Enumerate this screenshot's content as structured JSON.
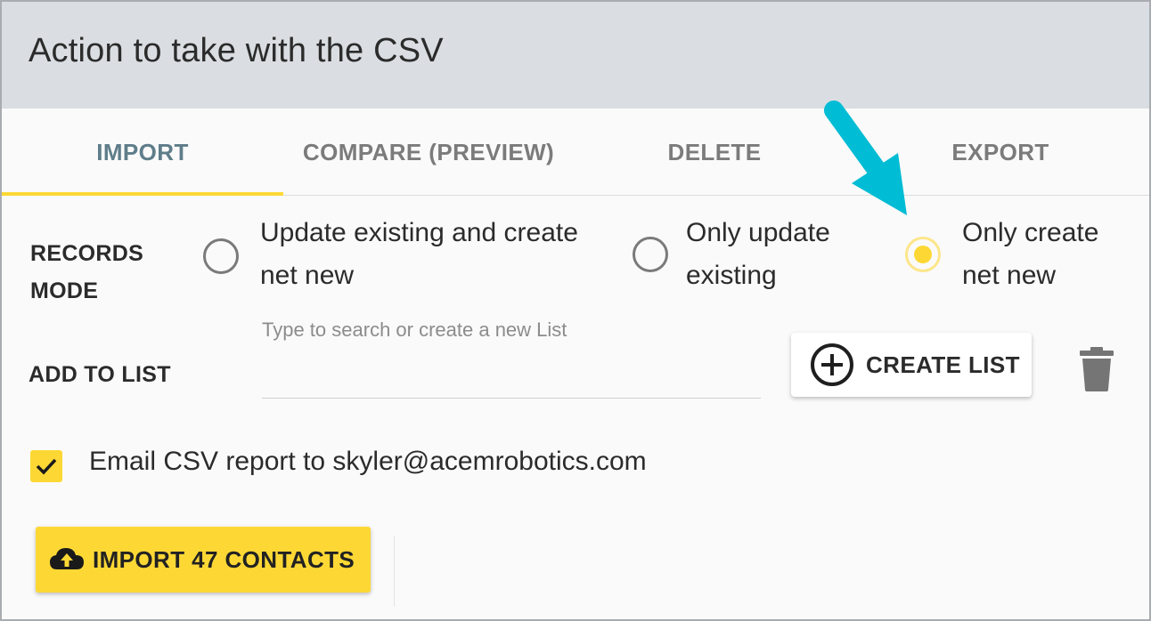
{
  "header": {
    "title": "Action to take with the CSV"
  },
  "tabs": [
    {
      "label": "IMPORT",
      "active": true
    },
    {
      "label": "COMPARE (PREVIEW)",
      "active": false
    },
    {
      "label": "DELETE",
      "active": false
    },
    {
      "label": "EXPORT",
      "active": false
    }
  ],
  "records_mode": {
    "label_line1": "RECORDS",
    "label_line2": "MODE",
    "options": [
      {
        "line1": "Update existing and create",
        "line2": "net new",
        "selected": false
      },
      {
        "line1": "Only update",
        "line2": "existing",
        "selected": false
      },
      {
        "line1": "Only create",
        "line2": "net new",
        "selected": true
      }
    ]
  },
  "add_to_list": {
    "label": "ADD TO LIST",
    "placeholder": "Type to search or create a new List",
    "value": "",
    "create_button": "CREATE LIST",
    "create_icon": "add-circle-icon",
    "delete_icon": "trash-icon"
  },
  "email_report": {
    "checked": true,
    "label": "Email CSV report to skyler@acemrobotics.com"
  },
  "import_button": {
    "label": "IMPORT 47 CONTACTS",
    "icon": "cloud-upload-icon"
  },
  "colors": {
    "accent": "#fdd835",
    "header_bg": "#dadee2",
    "active_tab": "#5f7d8a",
    "annotation_arrow": "#00bcd4"
  }
}
